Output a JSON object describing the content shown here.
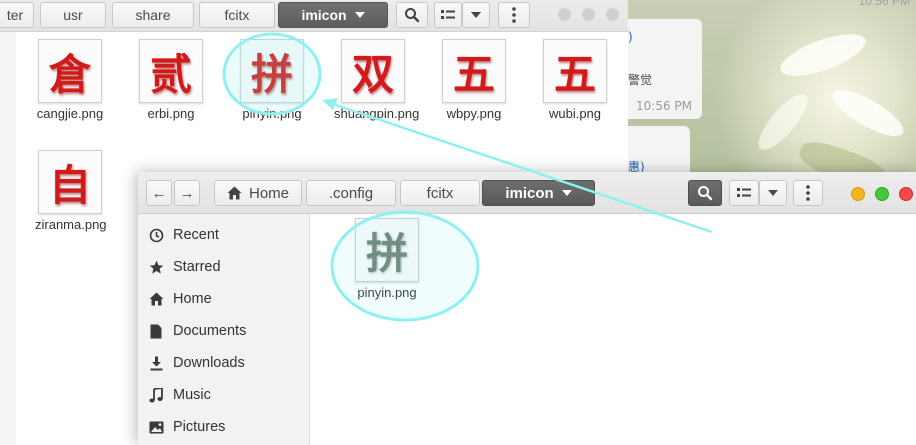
{
  "background_chat": {
    "time_top": "10:56 PM",
    "fragment_1": ")",
    "fragment_2": "警觉",
    "time_mid": "10:56 PM",
    "fragment_3": "惠)"
  },
  "back_window": {
    "breadcrumbs": [
      "ter",
      "usr",
      "share",
      "fcitx"
    ],
    "active_crumb": "imicon",
    "files": [
      {
        "glyph": "倉",
        "name": "cangjie.png"
      },
      {
        "glyph": "贰",
        "name": "erbi.png"
      },
      {
        "glyph": "拼",
        "name": "pinyin.png"
      },
      {
        "glyph": "双",
        "name": "shuangpin.png"
      },
      {
        "glyph": "五",
        "name": "wbpy.png"
      },
      {
        "glyph": "五",
        "name": "wubi.png"
      },
      {
        "glyph": "自",
        "name": "ziranma.png"
      }
    ]
  },
  "front_window": {
    "nav_back": "←",
    "nav_forward": "→",
    "home_crumb": "Home",
    "breadcrumbs": [
      ".config",
      "fcitx"
    ],
    "active_crumb": "imicon",
    "sidebar": [
      {
        "label": "Recent",
        "icon": "clock-icon"
      },
      {
        "label": "Starred",
        "icon": "star-icon"
      },
      {
        "label": "Home",
        "icon": "home-icon"
      },
      {
        "label": "Documents",
        "icon": "document-icon"
      },
      {
        "label": "Downloads",
        "icon": "download-icon"
      },
      {
        "label": "Music",
        "icon": "music-icon"
      },
      {
        "label": "Pictures",
        "icon": "picture-icon"
      }
    ],
    "file": {
      "glyph": "拼",
      "name": "pinyin.png"
    }
  },
  "colors": {
    "annotation": "#8ff0f0",
    "glyph_red": "#d21a1a",
    "glyph_gray": "#6f7f78",
    "close": "#f04a4a",
    "minimize": "#f5b523",
    "maximize": "#42c83a"
  }
}
